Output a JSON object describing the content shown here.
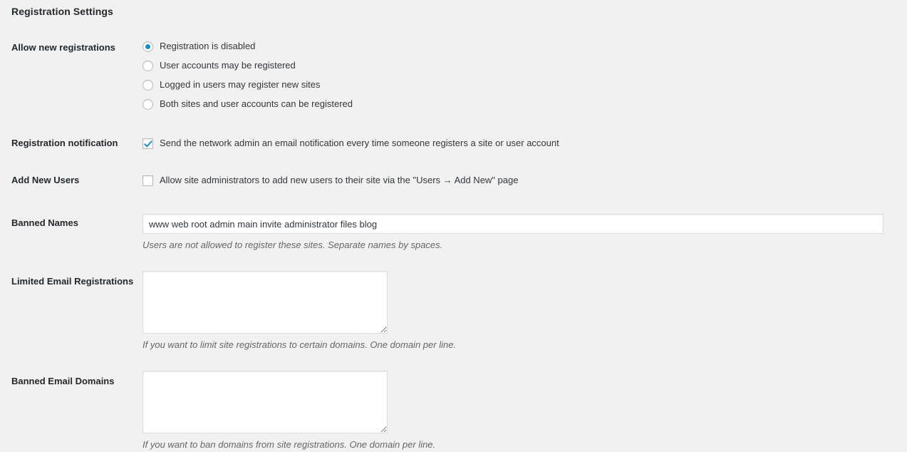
{
  "page": {
    "title": "Registration Settings",
    "accent_color": "#1e8cbe",
    "background_color": "#f1f1f1",
    "text_color": "#32373c",
    "label_color": "#23282d",
    "description_color": "#666666",
    "field_border_color": "#dddddd",
    "control_border_color": "#b4b9be"
  },
  "rows": {
    "allow_new_registrations": {
      "label": "Allow new registrations",
      "options": [
        {
          "label": "Registration is disabled",
          "selected": true
        },
        {
          "label": "User accounts may be registered",
          "selected": false
        },
        {
          "label": "Logged in users may register new sites",
          "selected": false
        },
        {
          "label": "Both sites and user accounts can be registered",
          "selected": false
        }
      ]
    },
    "registration_notification": {
      "label": "Registration notification",
      "checkbox_label": "Send the network admin an email notification every time someone registers a site or user account",
      "checked": true
    },
    "add_new_users": {
      "label": "Add New Users",
      "checkbox_label": "Allow site administrators to add new users to their site via the \"Users → Add New\" page",
      "checked": false
    },
    "banned_names": {
      "label": "Banned Names",
      "value": "www web root admin main invite administrator files blog",
      "placeholder": "",
      "description": "Users are not allowed to register these sites. Separate names by spaces."
    },
    "limited_email_registrations": {
      "label": "Limited Email Registrations",
      "value": "",
      "placeholder": "",
      "description": "If you want to limit site registrations to certain domains. One domain per line."
    },
    "banned_email_domains": {
      "label": "Banned Email Domains",
      "value": "",
      "placeholder": "",
      "description": "If you want to ban domains from site registrations. One domain per line."
    }
  }
}
